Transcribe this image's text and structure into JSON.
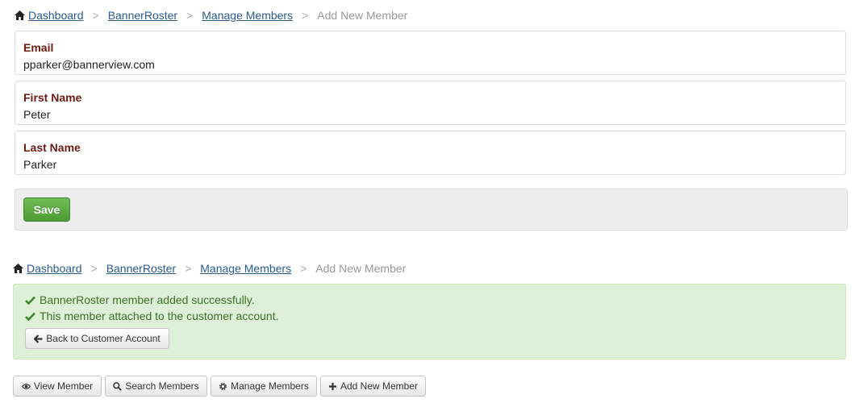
{
  "breadcrumb": {
    "items": [
      "Dashboard",
      "BannerRoster",
      "Manage Members"
    ],
    "separator": ">",
    "current": "Add New Member"
  },
  "form": {
    "fields": [
      {
        "label": "Email",
        "value": "pparker@bannerview.com"
      },
      {
        "label": "First Name",
        "value": "Peter"
      },
      {
        "label": "Last Name",
        "value": "Parker"
      }
    ],
    "save_label": "Save"
  },
  "alert": {
    "messages": [
      "BannerRoster member added successfully.",
      "This member attached to the customer account."
    ],
    "back_button_label": "Back to Customer Account"
  },
  "actions": {
    "view_member": "View Member",
    "search_members": "Search Members",
    "manage_members": "Manage Members",
    "add_new_member": "Add New Member"
  },
  "colors": {
    "link": "#2a5a8c",
    "field_label": "#6e1a12",
    "save_button": "#5aa640",
    "success_bg": "#dff0d8",
    "success_text": "#3c6f2a"
  },
  "icons": [
    "home-icon",
    "check-icon",
    "arrow-left-icon",
    "eye-icon",
    "search-icon",
    "gear-icon",
    "plus-icon"
  ]
}
